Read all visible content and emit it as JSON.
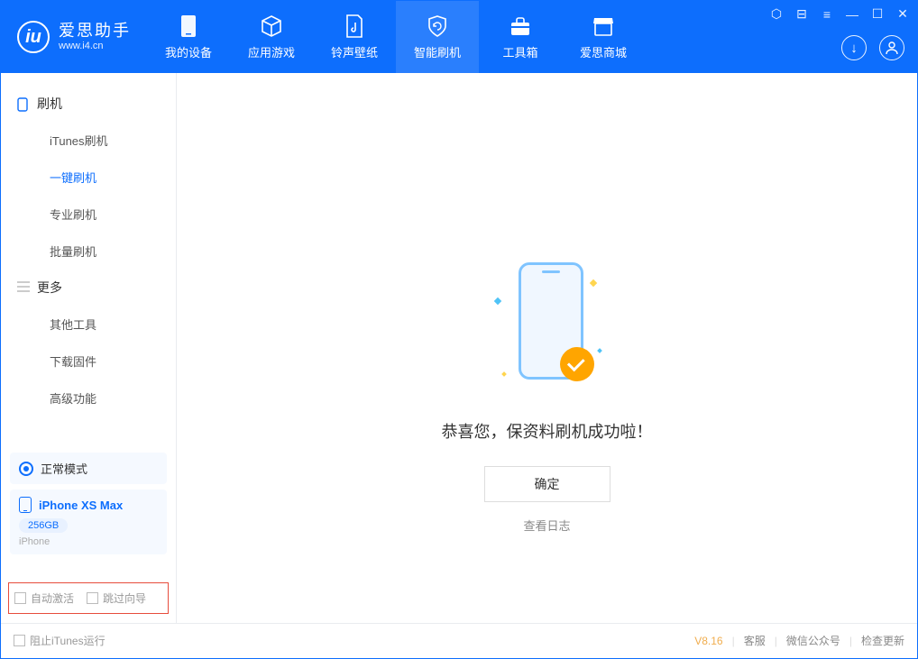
{
  "header": {
    "app_name": "爱思助手",
    "app_url": "www.i4.cn",
    "tabs": [
      {
        "label": "我的设备"
      },
      {
        "label": "应用游戏"
      },
      {
        "label": "铃声壁纸"
      },
      {
        "label": "智能刷机"
      },
      {
        "label": "工具箱"
      },
      {
        "label": "爱思商城"
      }
    ]
  },
  "sidebar": {
    "group_flash": "刷机",
    "group_more": "更多",
    "items_flash": [
      {
        "label": "iTunes刷机"
      },
      {
        "label": "一键刷机"
      },
      {
        "label": "专业刷机"
      },
      {
        "label": "批量刷机"
      }
    ],
    "items_more": [
      {
        "label": "其他工具"
      },
      {
        "label": "下载固件"
      },
      {
        "label": "高级功能"
      }
    ],
    "mode": "正常模式",
    "device": {
      "name": "iPhone XS Max",
      "storage": "256GB",
      "type": "iPhone"
    },
    "chk_auto_activate": "自动激活",
    "chk_skip_wizard": "跳过向导"
  },
  "main": {
    "success_text": "恭喜您，保资料刷机成功啦！",
    "ok_button": "确定",
    "view_log": "查看日志"
  },
  "footer": {
    "block_itunes": "阻止iTunes运行",
    "version": "V8.16",
    "support": "客服",
    "wechat": "微信公众号",
    "check_update": "检查更新"
  }
}
